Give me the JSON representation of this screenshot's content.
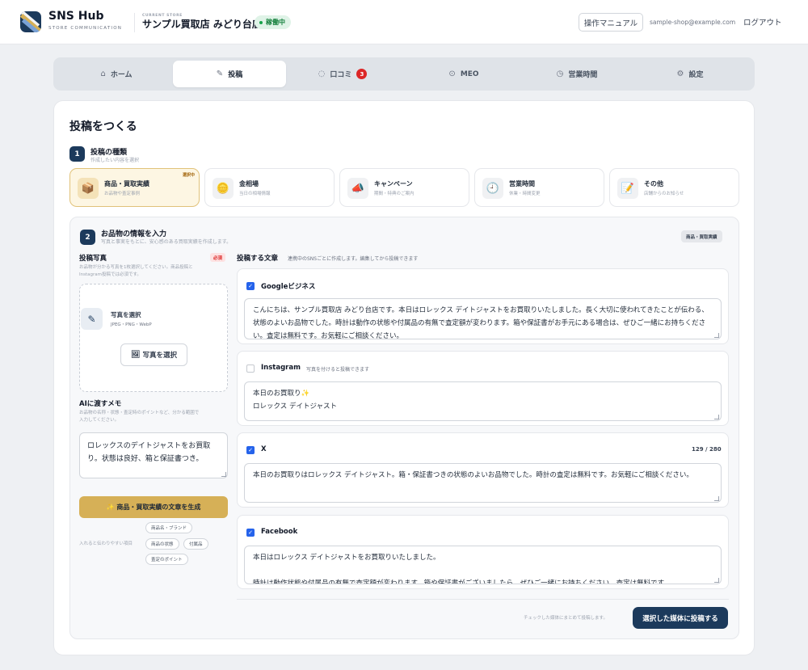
{
  "header": {
    "brand": "SNS Hub",
    "brand_sub": "STORE COMMUNICATION",
    "store_caption": "CURRENT STORE",
    "store_name": "サンプル買取店 みどり台店",
    "status": "稼働中",
    "manual": "操作マニュアル",
    "email": "sample-shop@example.com",
    "logout": "ログアウト"
  },
  "nav": {
    "home": "ホーム",
    "post": "投稿",
    "reviews": "口コミ",
    "reviews_count": "3",
    "meo": "MEO",
    "hours": "営業時間",
    "settings": "設定"
  },
  "page_title": "投稿をつくる",
  "step1": {
    "num": "1",
    "title": "投稿の種類",
    "sub": "作成したい内容を選択",
    "types": [
      {
        "name": "商品・買取実績",
        "desc": "お品物や査定事例",
        "icon": "📦",
        "badge": "選択中"
      },
      {
        "name": "金相場",
        "desc": "当日の相場情報",
        "icon": "🪙"
      },
      {
        "name": "キャンペーン",
        "desc": "期間・特典のご案内",
        "icon": "📣"
      },
      {
        "name": "営業時間",
        "desc": "休業・時間変更",
        "icon": "🕘"
      },
      {
        "name": "その他",
        "desc": "店舗からのお知らせ",
        "icon": "📝"
      }
    ]
  },
  "step2": {
    "num": "2",
    "title": "お品物の情報を入力",
    "sub": "写真と事実をもとに、安心感のある買取実績を作成します。",
    "type_pill": "商品・買取実績"
  },
  "photo": {
    "label": "投稿写真",
    "required": "必須",
    "desc_line1": "お品物が分かる写真を1枚選択してください。商品投稿と",
    "desc_line2": "Instagram投稿では必須です。",
    "select_title": "写真を選択",
    "formats": "JPEG・PNG・WebP",
    "button": "写真を選択"
  },
  "memo": {
    "label": "AIに渡すメモ",
    "desc_line1": "お品物の名称・状態・査定時のポイントなど、分かる範囲で",
    "desc_line2": "入力してください。",
    "value": "ロレックスのデイトジャストをお買取り。状態は良好、箱と保証書つき。"
  },
  "generate_button": "✨ 商品・買取実績の文章を生成",
  "hints": {
    "label": "入れると伝わりやすい項目",
    "chips": [
      "商品名・ブランド",
      "商品の状態",
      "付属品",
      "査定のポイント"
    ]
  },
  "posts": {
    "heading": "投稿する文章",
    "heading_sub": "連携中のSNSごとに作成します。編集してから投稿できます",
    "media": [
      {
        "name": "Googleビジネス",
        "checked": true,
        "text": "こんにちは、サンプル買取店 みどり台店です。本日はロレックス デイトジャストをお買取りいたしました。長く大切に使われてきたことが伝わる、状態のよいお品物でした。時計は動作の状態や付属品の有無で査定額が変わります。箱や保証書がお手元にある場合は、ぜひご一緒にお持ちください。査定は無料です。お気軽にご相談ください。"
      },
      {
        "name": "Instagram",
        "checked": false,
        "note": "写真を付けると投稿できます",
        "text": "本日のお買取り✨\nロレックス デイトジャスト"
      },
      {
        "name": "X",
        "checked": true,
        "count": "129 / 280",
        "text": "本日のお買取りはロレックス デイトジャスト。箱・保証書つきの状態のよいお品物でした。時計の査定は無料です。お気軽にご相談ください。"
      },
      {
        "name": "Facebook",
        "checked": true,
        "text": "本日はロレックス デイトジャストをお買取りいたしました。\n\n時計は動作状態や付属品の有無で査定額が変わります。箱や保証書がございましたら、ぜひご一緒にお持ちください。査定は無料です。"
      }
    ]
  },
  "footer": {
    "note": "チェックした媒体にまとめて投稿します。",
    "submit": "選択した媒体に投稿する"
  },
  "colors": {
    "primary": "#1c3a5c",
    "accent_gold": "#d6b057",
    "selected_bg": "#fdf6e3",
    "check_blue": "#2563eb",
    "badge_red": "#dc2626",
    "status_green": "#15803d"
  }
}
